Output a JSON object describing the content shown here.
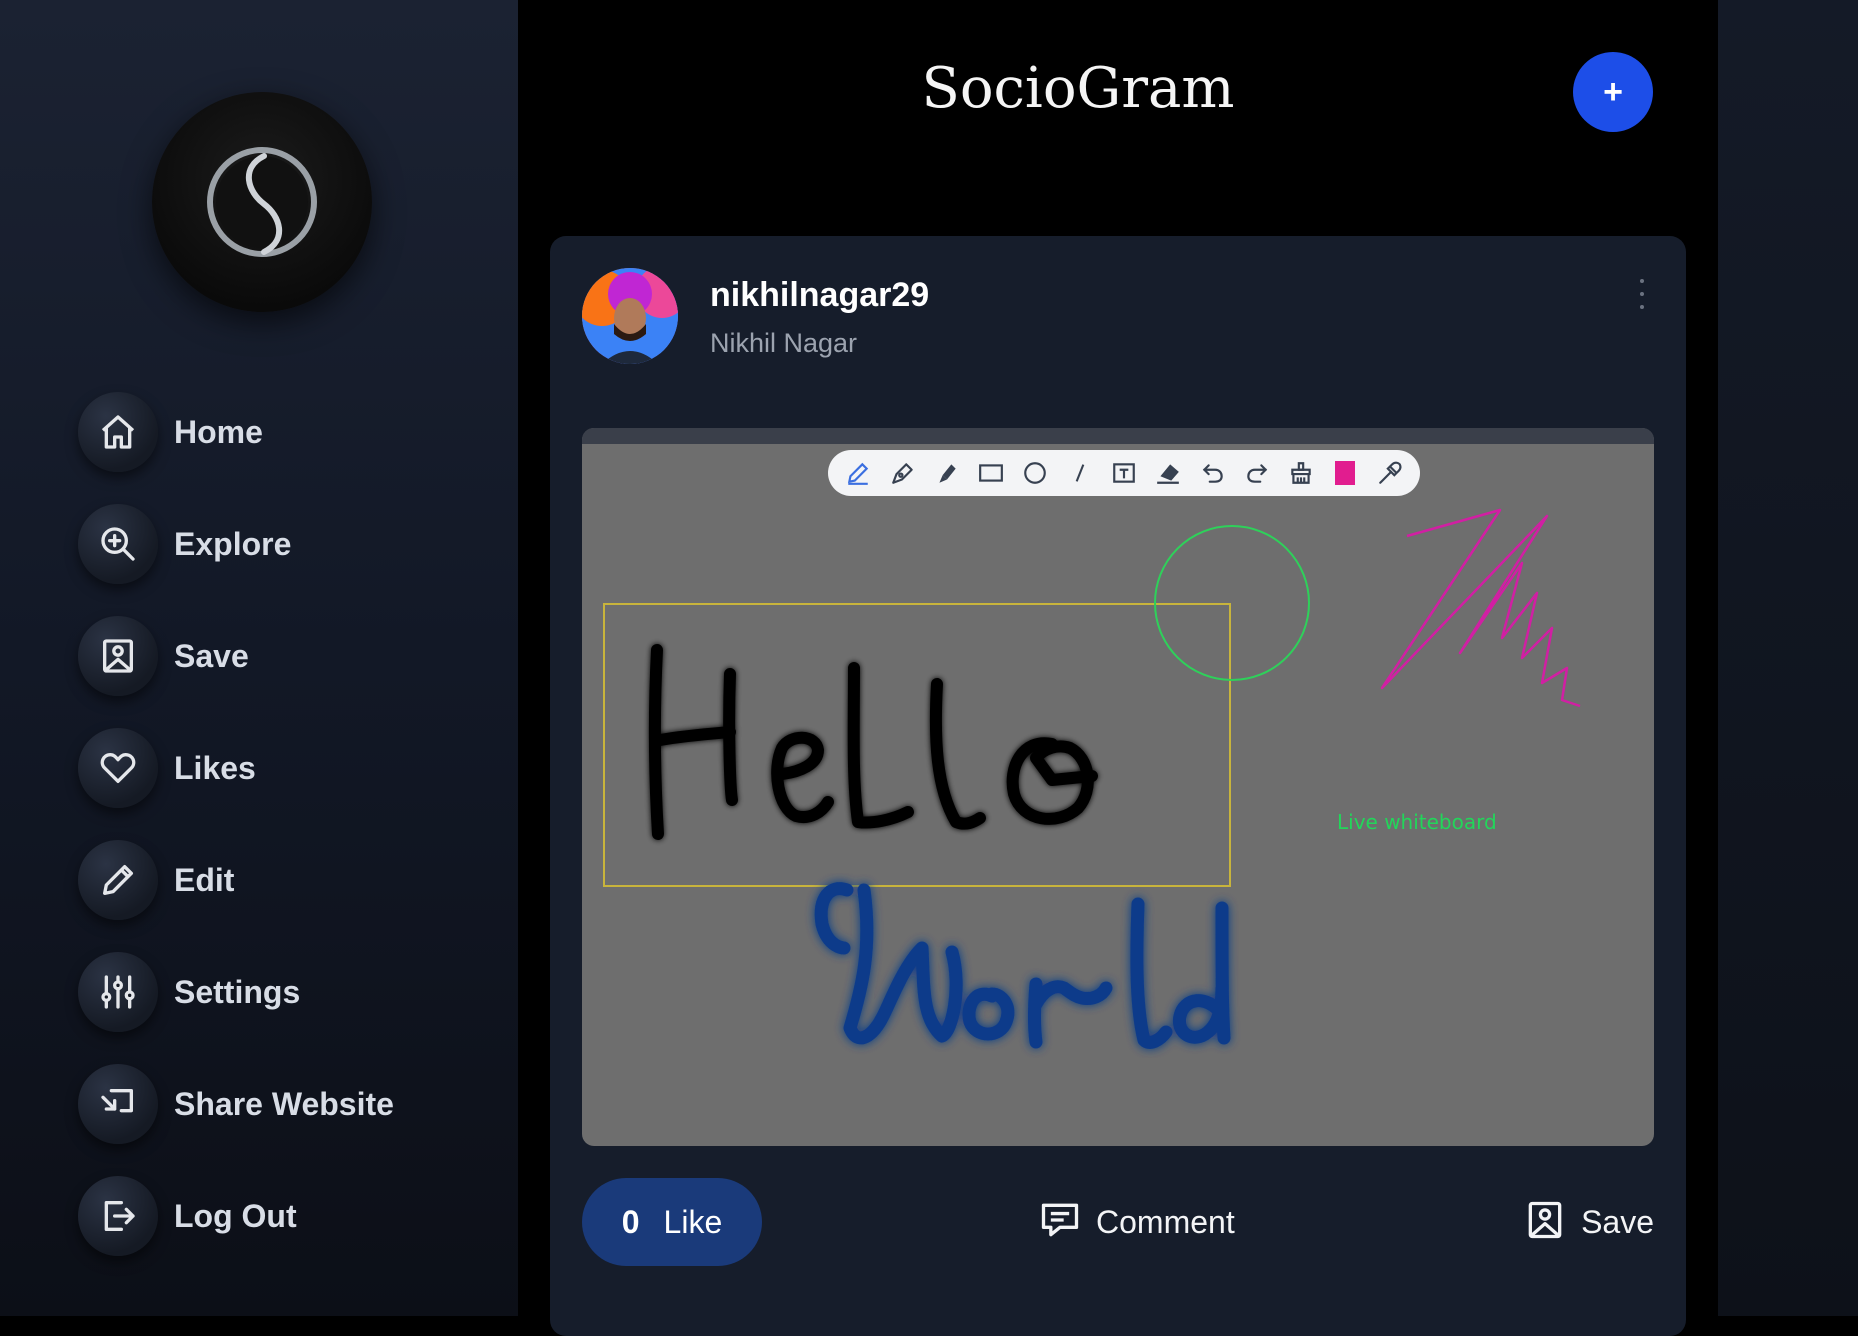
{
  "sidebar": {
    "items": [
      {
        "label": "Home",
        "icon": "home-icon"
      },
      {
        "label": "Explore",
        "icon": "zoom-in-icon"
      },
      {
        "label": "Save",
        "icon": "bookmark-icon"
      },
      {
        "label": "Likes",
        "icon": "heart-icon"
      },
      {
        "label": "Edit",
        "icon": "pencil-icon"
      },
      {
        "label": "Settings",
        "icon": "sliders-icon"
      },
      {
        "label": "Share Website",
        "icon": "share-icon"
      },
      {
        "label": "Log Out",
        "icon": "logout-icon"
      }
    ]
  },
  "header": {
    "title": "SocioGram",
    "add_label": "+"
  },
  "post": {
    "username": "nikhilnagar29",
    "full_name": "Nikhil Nagar",
    "whiteboard": {
      "tools": [
        "pencil-icon",
        "pen-icon",
        "highlighter-icon",
        "rectangle-icon",
        "circle-icon",
        "line-icon",
        "text-icon",
        "eraser-icon",
        "undo-icon",
        "redo-icon",
        "clear-icon",
        "color-swatch",
        "color-picker-icon"
      ],
      "selected_color": "#e11d8f",
      "live_label": "Live whiteboard"
    },
    "like_count": "0",
    "like_label": "Like",
    "comment_label": "Comment",
    "save_label": "Save"
  },
  "colors": {
    "accent": "#1d4ee8",
    "like_bg": "#1a3a7a"
  }
}
